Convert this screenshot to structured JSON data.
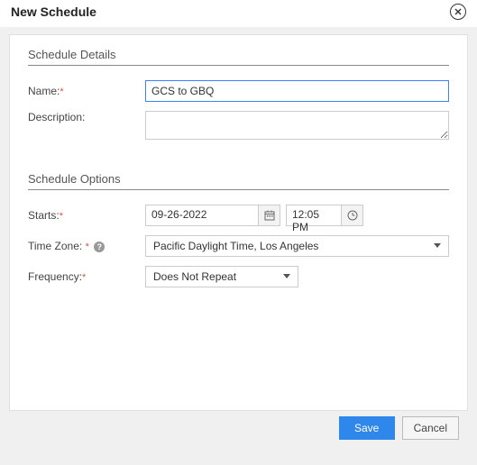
{
  "header": {
    "title": "New Schedule"
  },
  "sections": {
    "details": {
      "heading": "Schedule Details",
      "name_label": "Name:",
      "name_value": "GCS to GBQ",
      "description_label": "Description:",
      "description_value": ""
    },
    "options": {
      "heading": "Schedule Options",
      "starts_label": "Starts:",
      "starts_date": "09-26-2022",
      "starts_time": "12:05 PM",
      "timezone_label": "Time Zone:",
      "timezone_value": "Pacific Daylight Time, Los Angeles",
      "frequency_label": "Frequency:",
      "frequency_value": "Does Not Repeat"
    }
  },
  "footer": {
    "save_label": "Save",
    "cancel_label": "Cancel"
  }
}
